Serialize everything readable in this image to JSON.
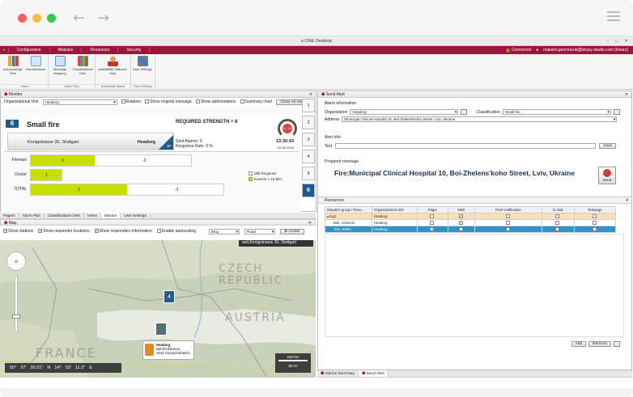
{
  "app": {
    "title": "s.ONE Desktop",
    "menu": [
      "Configuration",
      "Modules",
      "Resources",
      "Security"
    ],
    "status": "Connected",
    "user": "maksim.goncharuk@binary-studio.com (binary)"
  },
  "ribbon": {
    "groups": [
      {
        "label": "Alarm",
        "buttons": [
          "Acknowledge Sets",
          "Visualizations"
        ]
      },
      {
        "label": "Alarm Plan",
        "buttons": [
          "Message Mapping",
          "Classifications Sets"
        ]
      },
      {
        "label": "Availability Status",
        "buttons": [
          "Availability Statuses Sets"
        ]
      },
      {
        "label": "User Settings",
        "buttons": [
          "User Settings"
        ]
      }
    ]
  },
  "monitor": {
    "title": "Monitor",
    "org_label": "Organizational Unit",
    "org_value": "Headorg",
    "options": [
      "Rotation",
      "Show original message",
      "Show abbreviations",
      "Summary chart"
    ],
    "close_all": "Close All Alarms",
    "alarm": {
      "number": "6",
      "name": "Small fire",
      "address": "Konigstrasse 30, Stuttgart",
      "source": "Headorg",
      "badge": "SF",
      "required_strength": "REQUIRED STRENGTH = 6",
      "sent_alarms": "Sent Alarms: 0",
      "response_rate": "Response Rate: 0 %",
      "gauge": "0 / 12",
      "time": "13:30:43",
      "date": "02.06.2016"
    },
    "qualifications": [
      {
        "label": "Fireman",
        "required": "2",
        "missing": "-2",
        "fill": 0.4
      },
      {
        "label": "Doctor",
        "required": "1",
        "missing": "",
        "fill": 0.2
      },
      {
        "label": "TOTAL",
        "required": "3",
        "missing": "-3",
        "fill": 0.5
      }
    ],
    "legend": [
      "Still Required",
      "Komms > 15 Min."
    ],
    "numbers": [
      "1",
      "2",
      "3",
      "4",
      "5",
      "6"
    ]
  },
  "lower_tabs": [
    "Pagers",
    "Alarm Plan",
    "Classifications Sets",
    "Users",
    "Monitor",
    "User Settings"
  ],
  "map": {
    "title": "Map",
    "options": [
      "Show stations",
      "Show responder locations",
      "Show responders information",
      "Enable autoscaling"
    ],
    "provider": "Bing",
    "mode": "Road",
    "center": "Center",
    "tooltip": "asd,Konigstrasse 30, Stuttgart",
    "countries": [
      "CZECH REPUBLIC",
      "AUSTRIA",
      "FRANCE"
    ],
    "marker_count": "4",
    "station": {
      "name": "Headorg",
      "street": "Bahnhofstrasse",
      "city": "3943 Gampel-Bratsch"
    },
    "coords": [
      "50°",
      "37'",
      "20.01''",
      "N",
      "14°",
      "53'",
      "11.3''",
      "E"
    ],
    "scale_km": "100 km",
    "scale_mi": "50 mi"
  },
  "send_alert": {
    "title": "Send Alert",
    "alarm_info": "Alarm information",
    "organization_label": "Organization",
    "organization": "Headorg",
    "classification_label": "Classification",
    "classification": "Small fire",
    "address_label": "Address",
    "address": "Municipal Clinical Hospital 10, Boi-Zhelens'koho Street, Lviv, Ukraine",
    "alert_info": "Alert info",
    "text_label": "Text",
    "save": "Save",
    "prepared_label": "Prepared message",
    "prepared": "Fire:Municipal Clinical Hospital 10, Boi-Zhelens'koho Street, Lviv, Ukraine",
    "send": "Send",
    "resources_label": "Resources",
    "columns": [
      "Dispatch group / Reso...",
      "Organizational Unit",
      "Pager",
      "SMS",
      "Push notification",
      "E-mail",
      "Telepage"
    ],
    "rows": [
      {
        "name": "Dg1",
        "org": "Headorg",
        "pager": false,
        "sms": true,
        "push": false,
        "email": false,
        "tele": false,
        "style": "group"
      },
      {
        "name": "Bob, Johnson",
        "org": "Headorg",
        "pager": false,
        "sms": true,
        "push": false,
        "email": false,
        "tele": false,
        "style": "normal"
      },
      {
        "name": "Tom, Moller",
        "org": "Headorg",
        "pager": true,
        "sms": false,
        "push": false,
        "email": false,
        "tele": false,
        "style": "selected"
      }
    ],
    "add": "Add",
    "remove": "Remove"
  },
  "bottom_tabs": [
    "Alarms Summary",
    "Send Alert"
  ],
  "colors": {
    "brand": "#a3123a",
    "accent": "#1e5a8c",
    "bar": "#c7e000",
    "selected_row": "#2e93c9",
    "group_row": "#fbe0b7"
  }
}
